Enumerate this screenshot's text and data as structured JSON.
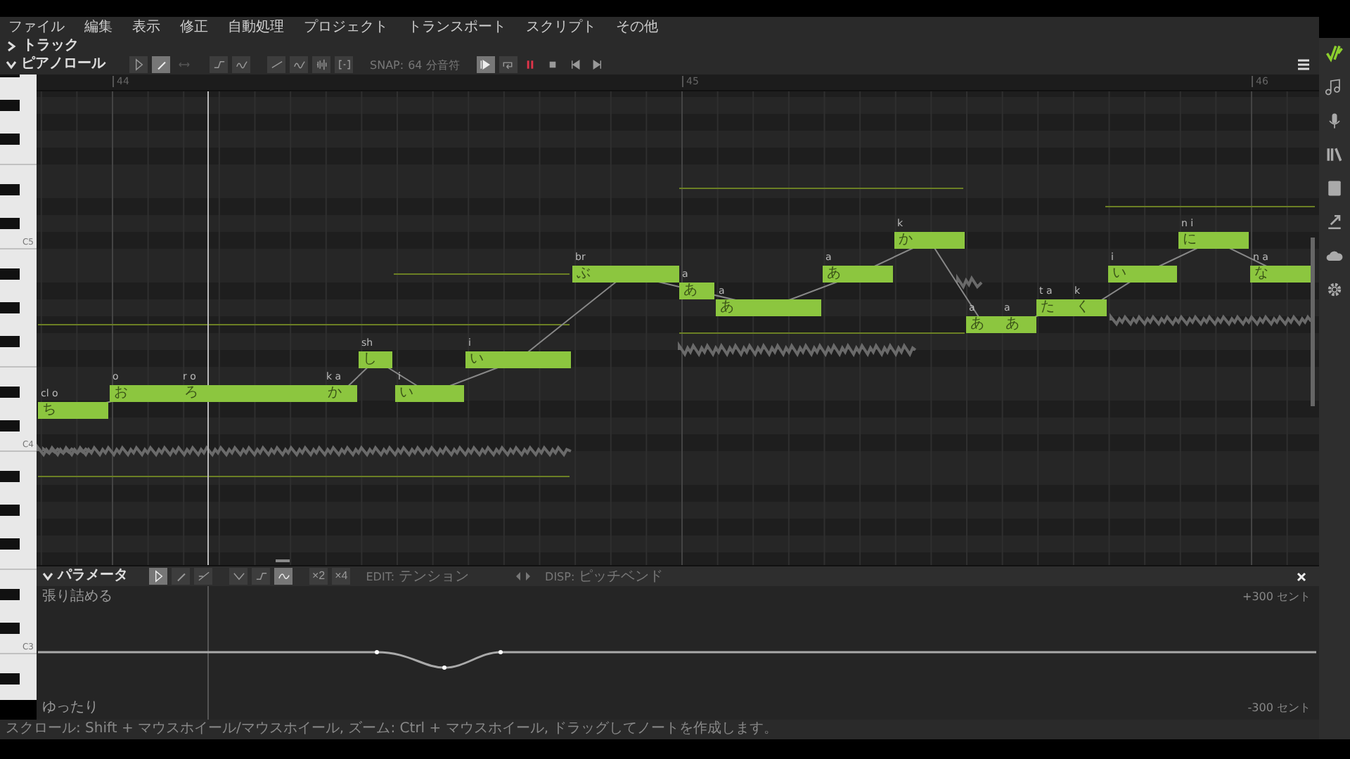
{
  "menu": [
    "ファイル",
    "編集",
    "表示",
    "修正",
    "自動処理",
    "プロジェクト",
    "トランスポート",
    "スクリプト",
    "その他"
  ],
  "track_section": {
    "label": "トラック",
    "expanded": false
  },
  "piano_roll": {
    "label": "ピアノロール",
    "expanded": true,
    "tools": [
      {
        "kind": "pointer",
        "selected": false
      },
      {
        "kind": "pen",
        "selected": true
      },
      {
        "kind": "resize",
        "selected": false,
        "disabled": true
      },
      {
        "kind": "note-curve",
        "selected": false
      },
      {
        "kind": "vibrato",
        "selected": false
      },
      {
        "kind": "pitch-line",
        "selected": false
      },
      {
        "kind": "pitch-wave",
        "selected": false
      },
      {
        "kind": "waveform",
        "selected": false
      },
      {
        "kind": "bracket",
        "selected": false
      }
    ],
    "snap_label": "SNAP:",
    "snap_value": "64 分音符",
    "transport": [
      {
        "kind": "follow",
        "selected": true
      },
      {
        "kind": "loop",
        "selected": false
      },
      {
        "kind": "pause",
        "selected": false
      },
      {
        "kind": "stop",
        "selected": false
      },
      {
        "kind": "previous",
        "selected": false
      },
      {
        "kind": "next",
        "selected": false
      }
    ]
  },
  "ruler": [
    "44",
    "45",
    "46"
  ],
  "keyboard": {
    "labels": [
      "C5",
      "C4",
      "C3"
    ]
  },
  "notes": [
    {
      "lyric": "ち",
      "phoneme": "cl o"
    },
    {
      "lyric": "お",
      "phoneme": "o"
    },
    {
      "lyric": "ろ",
      "phoneme": "r o"
    },
    {
      "lyric": "か",
      "phoneme": "k a"
    },
    {
      "lyric": "し",
      "phoneme": "sh"
    },
    {
      "lyric": "い",
      "phoneme": "i"
    },
    {
      "lyric": "い",
      "phoneme": "i"
    },
    {
      "lyric": "ぶ",
      "phoneme": "br"
    },
    {
      "lyric": "あ",
      "phoneme": "a"
    },
    {
      "lyric": "あ",
      "phoneme": "a"
    },
    {
      "lyric": "あ",
      "phoneme": "a"
    },
    {
      "lyric": "か",
      "phoneme": "k"
    },
    {
      "lyric": "あ",
      "phoneme": "a"
    },
    {
      "lyric": "あ",
      "phoneme": "a"
    },
    {
      "lyric": "た",
      "phoneme": "t a"
    },
    {
      "lyric": "く",
      "phoneme": "k"
    },
    {
      "lyric": "い",
      "phoneme": "i"
    },
    {
      "lyric": "に",
      "phoneme": "n i"
    },
    {
      "lyric": "な",
      "phoneme": "n a"
    }
  ],
  "parameters": {
    "label": "パラメータ",
    "expanded": true,
    "tools": [
      {
        "kind": "pointer",
        "selected": true
      },
      {
        "kind": "pen",
        "selected": false
      },
      {
        "kind": "line",
        "selected": false
      },
      {
        "kind": "valley",
        "selected": false
      },
      {
        "kind": "ramp",
        "selected": false
      },
      {
        "kind": "wave",
        "selected": true
      }
    ],
    "multipliers": [
      "×2",
      "×4"
    ],
    "edit_label": "EDIT:",
    "edit_value": "テンション",
    "disp_label": "DISP:",
    "disp_value": "ピッチベンド",
    "top_label": "張り詰める",
    "bottom_label": "ゆったり",
    "max_label": "+300 セント",
    "min_label": "-300 セント"
  },
  "status_bar": "スクロール: Shift + マウスホイール/マウスホイール, ズーム: Ctrl + マウスホイール, ドラッグしてノートを作成します。",
  "sidebar": [
    {
      "kind": "logo"
    },
    {
      "kind": "note"
    },
    {
      "kind": "mic"
    },
    {
      "kind": "library"
    },
    {
      "kind": "book"
    },
    {
      "kind": "export"
    },
    {
      "kind": "cloud"
    },
    {
      "kind": "gear"
    }
  ]
}
